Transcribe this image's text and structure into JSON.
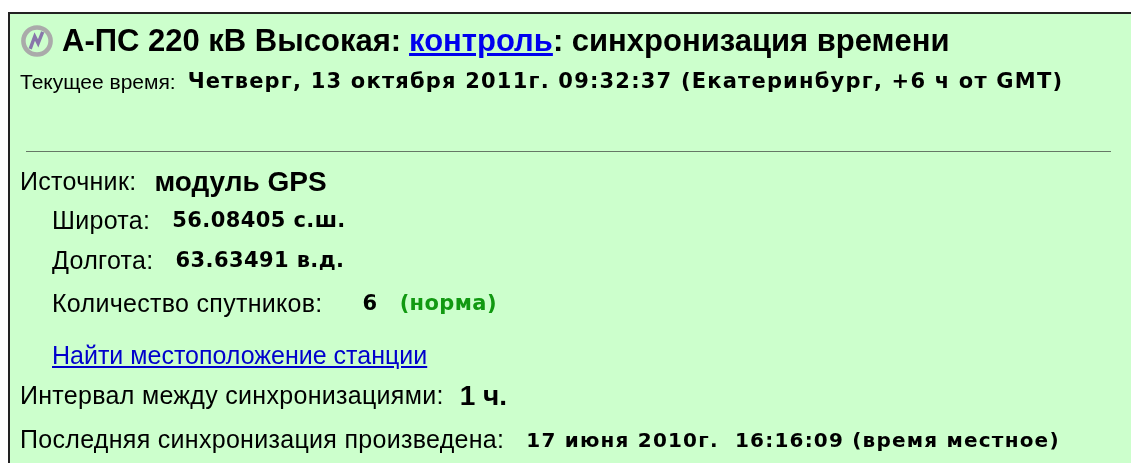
{
  "header": {
    "station": "А-ПС 220 кВ Высокая:",
    "link": "контроль",
    "rest": ": синхронизация времени"
  },
  "current_time": {
    "label": "Текущее время:",
    "value": "Четверг, 13 октября 2011г. 09:32:37 (Екатеринбург, +6 ч от GMT)"
  },
  "source": {
    "label": "Источник:",
    "value": "модуль GPS"
  },
  "gps": [
    {
      "label": "Широта:",
      "value": "56.08405 с.ш."
    },
    {
      "label": "Долгота:",
      "value": "63.63491 в.д."
    },
    {
      "label": "Количество спутников:",
      "value": "6",
      "status": "(норма)",
      "status_ok": true
    }
  ],
  "locate_link": "Найти местоположение станции",
  "interval": {
    "label": "Интервал между синхронизациями:",
    "value": "1 ч."
  },
  "last_sync": {
    "label": "Последняя синхронизация произведена:",
    "value": "17 июня 2010г.  16:16:09 (время местное)"
  }
}
